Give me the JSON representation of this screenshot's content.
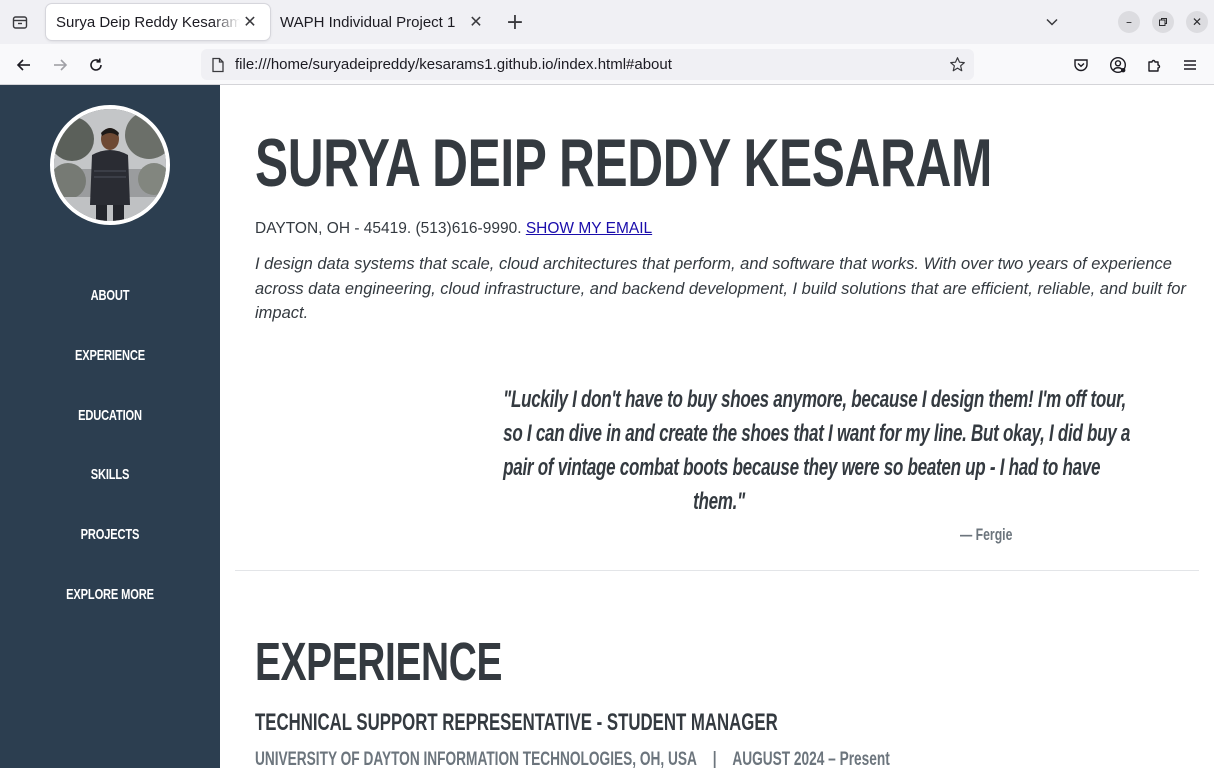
{
  "browser": {
    "tabs": [
      {
        "title": "Surya Deip Reddy Kesaram - Ho",
        "active": true
      },
      {
        "title": "WAPH Individual Project 1",
        "active": false
      }
    ],
    "url": "file:///home/suryadeipreddy/kesarams1.github.io/index.html#about"
  },
  "sidebar": {
    "nav": [
      "ABOUT",
      "EXPERIENCE",
      "EDUCATION",
      "SKILLS",
      "PROJECTS",
      "EXPLORE MORE"
    ]
  },
  "about": {
    "name": "SURYA DEIP REDDY KESARAM",
    "contact_prefix": "DAYTON, OH - 45419. (513)616-9990. ",
    "email_link": "SHOW MY EMAIL",
    "intro": "I design data systems that scale, cloud architectures that perform, and software that works. With over two years of experience across data engineering, cloud infrastructure, and backend development, I build solutions that are efficient, reliable, and built for impact.",
    "quote_lines": [
      "\"Luckily I don't have to buy shoes anymore, because I design them! I'm off tour,",
      "so I can dive in and create the shoes that I want for my line. But okay, I did buy a",
      "pair of vintage combat boots because they were so beaten up - I had to have",
      "them.\""
    ],
    "quote_author": "— Fergie"
  },
  "experience": {
    "heading": "EXPERIENCE",
    "job_title": "TECHNICAL SUPPORT REPRESENTATIVE - STUDENT MANAGER",
    "org": "UNIVERSITY OF DAYTON INFORMATION TECHNOLOGIES, OH, USA",
    "separator": "|",
    "dates": "AUGUST 2024 – Present"
  },
  "colors": {
    "sidebar_bg": "#2c3e50",
    "text_dark": "#343a40",
    "text_muted": "#6c757d",
    "link": "#1a0dab"
  }
}
